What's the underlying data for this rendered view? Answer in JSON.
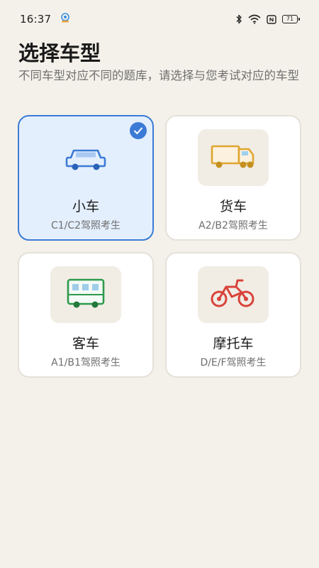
{
  "status_bar": {
    "time": "16:37",
    "icons": [
      "notification-icon",
      "bluetooth-icon",
      "wifi-icon",
      "nfc-icon",
      "battery-icon"
    ],
    "battery_level": "71"
  },
  "header": {
    "title": "选择车型",
    "subtitle": "不同车型对应不同的题库，请选择与您考试对应的车型"
  },
  "vehicle_types": [
    {
      "title": "小车",
      "desc": "C1/C2驾照考生",
      "icon": "car-icon",
      "selected": true,
      "color": "#3b7bd6"
    },
    {
      "title": "货车",
      "desc": "A2/B2驾照考生",
      "icon": "truck-icon",
      "selected": false,
      "color": "#e0a52f"
    },
    {
      "title": "客车",
      "desc": "A1/B1驾照考生",
      "icon": "bus-icon",
      "selected": false,
      "color": "#2e9a4c"
    },
    {
      "title": "摩托车",
      "desc": "D/E/F驾照考生",
      "icon": "motorcycle-icon",
      "selected": false,
      "color": "#d9433a"
    }
  ],
  "colors": {
    "background": "#f4f1ea",
    "selected_border": "#3b7bd6",
    "selected_bg": "#e4effd"
  }
}
